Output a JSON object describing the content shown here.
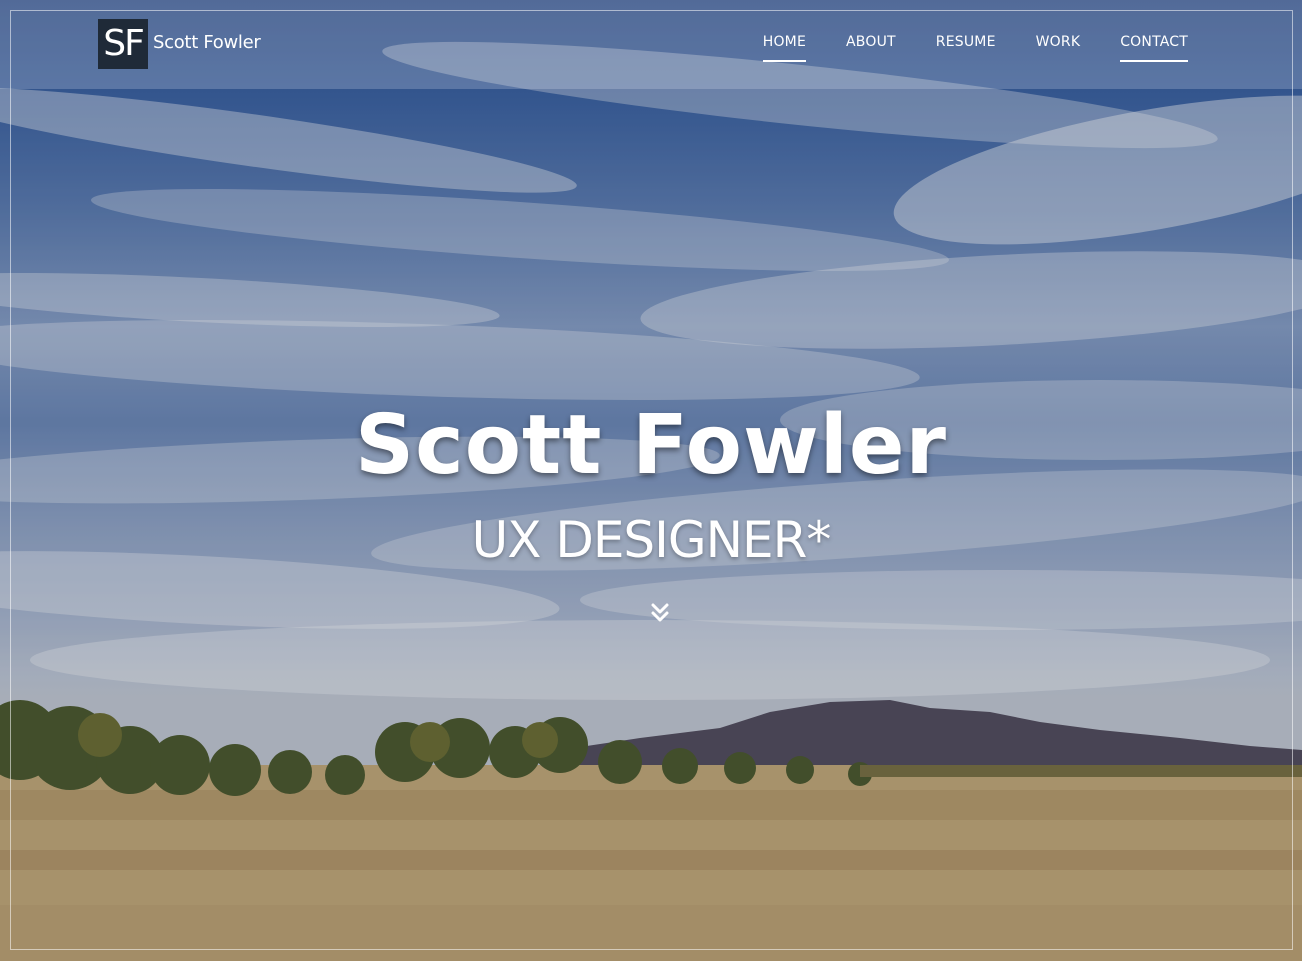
{
  "brand": {
    "logo_text": "SF",
    "name": "Scott Fowler"
  },
  "nav": {
    "items": [
      {
        "label": "HOME",
        "active": true
      },
      {
        "label": "ABOUT",
        "active": false
      },
      {
        "label": "RESUME",
        "active": false
      },
      {
        "label": "WORK",
        "active": false
      },
      {
        "label": "CONTACT",
        "active": true
      }
    ]
  },
  "hero": {
    "title": "Scott Fowler",
    "subtitle": "UX DESIGNER*",
    "scroll_icon": "double-chevron-down-icon",
    "background_image": "landscape-photo-sky-mountain-grassland"
  },
  "colors": {
    "logo_bg": "#1f2a38",
    "text": "#ffffff",
    "sky": "#3c63a3",
    "grass": "#c8ad78"
  }
}
